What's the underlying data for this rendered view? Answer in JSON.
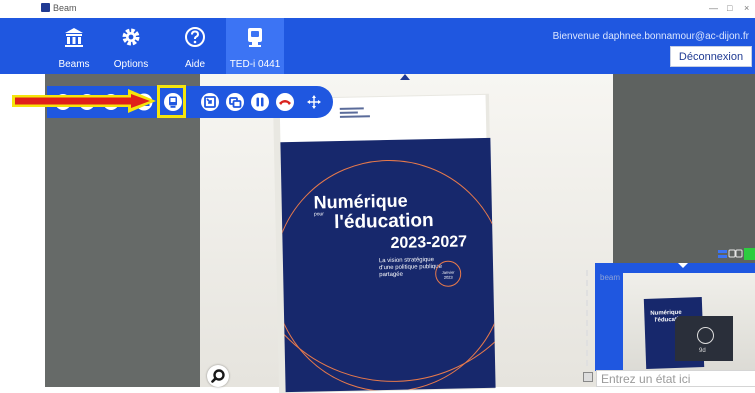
{
  "window": {
    "title": "Beam",
    "controls": [
      "—",
      "□",
      "×"
    ]
  },
  "nav": [
    {
      "label": "Beams",
      "icon": "beams-building-icon"
    },
    {
      "label": "Options",
      "icon": "gear-icon"
    },
    {
      "label": "Aide",
      "icon": "help-icon"
    },
    {
      "label": "TED-i 0441",
      "icon": "robot-icon"
    }
  ],
  "header": {
    "welcome": "Bienvenue daphnee.bonnamour@ac-dijon.fr",
    "logout": "Déconnexion"
  },
  "brochure": {
    "title1": "Numérique",
    "small": "pour",
    "title2": "l'éducation",
    "years": "2023-2027",
    "subtitle": [
      "La vision stratégique",
      "d'une politique publique",
      "partagée"
    ],
    "badge": [
      "Janvier",
      "2023"
    ]
  },
  "self_view": {
    "brand": "beam",
    "doc_title1": "Numérique",
    "doc_title2": "l'éducation",
    "robot_label": "9d"
  },
  "status": {
    "placeholder": "Entrez un état ici"
  },
  "colors": {
    "brand_blue": "#1f57e0",
    "active_tab": "#3c74f4",
    "highlight": "#f5e50c",
    "arrow_red": "#e0201a",
    "volume_green": "#2ecc40"
  }
}
